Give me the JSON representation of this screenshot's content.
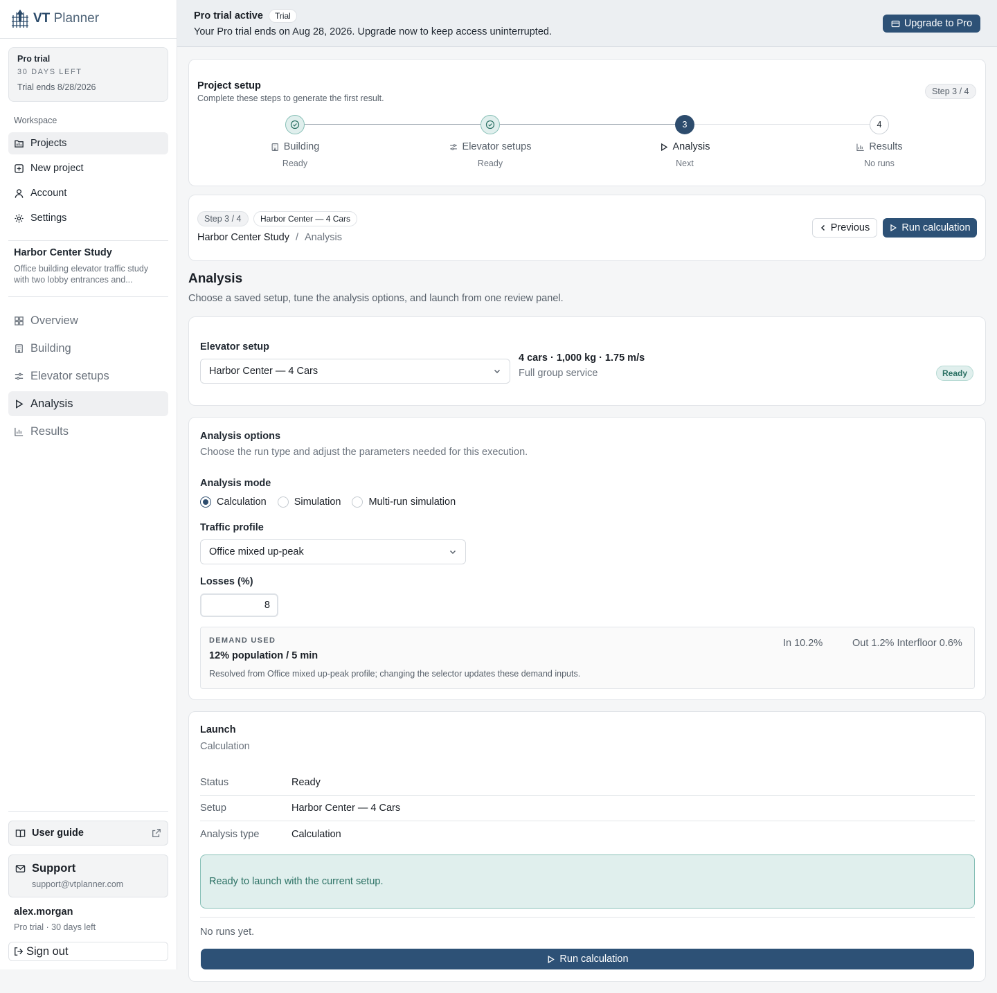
{
  "app": {
    "logo_bold": "VT",
    "logo_light": "Planner"
  },
  "sidebar": {
    "trial": {
      "title": "Pro trial",
      "days_left": "30 DAYS LEFT",
      "ends": "Trial ends 8/28/2026"
    },
    "workspace_label": "Workspace",
    "workspace_items": [
      {
        "label": "Projects",
        "icon": "folder-icon"
      },
      {
        "label": "New project",
        "icon": "plus-square-icon"
      },
      {
        "label": "Account",
        "icon": "user-icon"
      },
      {
        "label": "Settings",
        "icon": "gear-icon"
      }
    ],
    "project": {
      "title": "Harbor Center Study",
      "description": "Office building elevator traffic study with two lobby entrances and..."
    },
    "project_items": [
      {
        "label": "Overview",
        "icon": "grid-icon"
      },
      {
        "label": "Building",
        "icon": "building-icon"
      },
      {
        "label": "Elevator setups",
        "icon": "sliders-icon"
      },
      {
        "label": "Analysis",
        "icon": "play-icon"
      },
      {
        "label": "Results",
        "icon": "bar-chart-icon"
      }
    ],
    "user_guide": "User guide",
    "support": {
      "title": "Support",
      "email": "support@vtplanner.com"
    },
    "user": {
      "name": "alex.morgan",
      "plan": "Pro trial · 30 days left"
    },
    "sign_out": "Sign out"
  },
  "banner": {
    "title": "Pro trial active",
    "badge": "Trial",
    "message": "Your Pro trial ends on Aug 28, 2026. Upgrade now to keep access uninterrupted.",
    "upgrade_label": "Upgrade to Pro"
  },
  "setup": {
    "title": "Project setup",
    "subtitle": "Complete these steps to generate the first result.",
    "step_badge": "Step 3 / 4",
    "steps": [
      {
        "label": "Building",
        "status": "Ready",
        "number": ""
      },
      {
        "label": "Elevator setups",
        "status": "Ready",
        "number": ""
      },
      {
        "label": "Analysis",
        "status": "Next",
        "number": "3"
      },
      {
        "label": "Results",
        "status": "No runs",
        "number": "4"
      }
    ]
  },
  "context": {
    "step_badge": "Step 3 / 4",
    "setup_badge": "Harbor Center — 4 Cars",
    "crumb_project": "Harbor Center Study",
    "crumb_sep": "/",
    "crumb_page": "Analysis",
    "previous_label": "Previous",
    "run_label": "Run calculation"
  },
  "page": {
    "title": "Analysis",
    "subtitle": "Choose a saved setup, tune the analysis options, and launch from one review panel."
  },
  "elevator": {
    "label": "Elevator setup",
    "selected": "Harbor Center — 4 Cars",
    "summary": "4 cars · 1,000 kg · 1.75 m/s",
    "service": "Full group service",
    "status": "Ready"
  },
  "options": {
    "title": "Analysis options",
    "subtitle": "Choose the run type and adjust the parameters needed for this execution.",
    "mode_label": "Analysis mode",
    "modes": [
      {
        "label": "Calculation",
        "selected": true
      },
      {
        "label": "Simulation",
        "selected": false
      },
      {
        "label": "Multi-run simulation",
        "selected": false
      }
    ],
    "traffic_label": "Traffic profile",
    "traffic_selected": "Office mixed up-peak",
    "losses_label": "Losses (%)",
    "losses_value": "8",
    "demand": {
      "heading": "DEMAND USED",
      "value": "12% population / 5 min",
      "note": "Resolved from Office mixed up-peak profile; changing the selector updates these demand inputs.",
      "in": "In 10.2%",
      "out_inter": "Out 1.2% Interfloor 0.6%"
    }
  },
  "launch": {
    "title": "Launch",
    "subtitle": "Calculation",
    "rows": [
      {
        "key": "Status",
        "value": "Ready"
      },
      {
        "key": "Setup",
        "value": "Harbor Center — 4 Cars"
      },
      {
        "key": "Analysis type",
        "value": "Calculation"
      }
    ],
    "notice": "Ready to launch with the current setup.",
    "no_runs": "No runs yet.",
    "run_label": "Run calculation"
  },
  "colors": {
    "primary": "#2d5176",
    "success_bg": "#e0efed",
    "success_text": "#2a7063"
  }
}
